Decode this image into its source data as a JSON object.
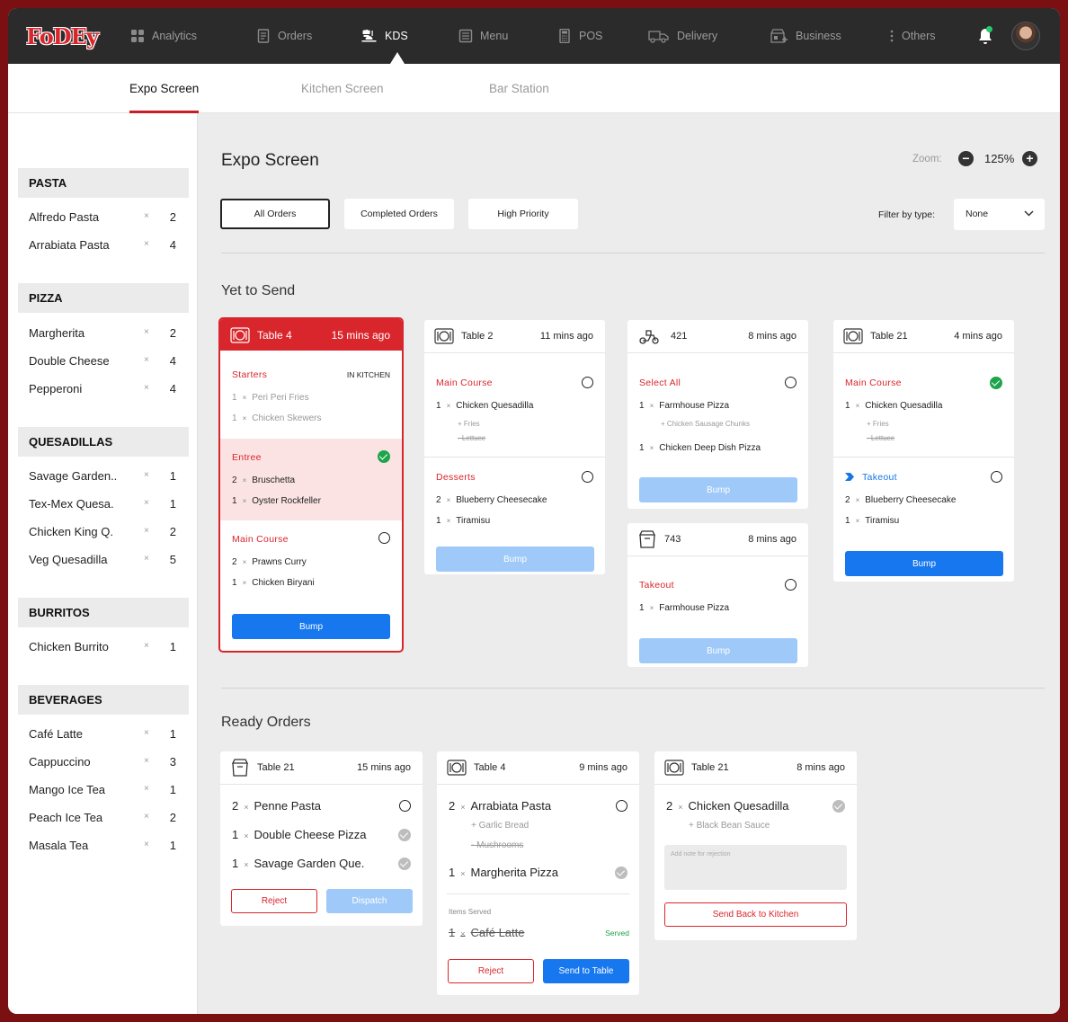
{
  "brand": {
    "logo": "FoDEy",
    "accent": "#d9262c"
  },
  "nav": {
    "items": [
      {
        "label": "Analytics",
        "icon": "grid-icon"
      },
      {
        "label": "Orders",
        "icon": "document-icon"
      },
      {
        "label": "KDS",
        "icon": "chef-icon",
        "active": true
      },
      {
        "label": "Menu",
        "icon": "book-icon"
      },
      {
        "label": "POS",
        "icon": "calculator-icon"
      },
      {
        "label": "Delivery",
        "icon": "truck-icon"
      },
      {
        "label": "Business",
        "icon": "store-icon"
      },
      {
        "label": "Others",
        "icon": "more-vertical-icon"
      }
    ]
  },
  "subnav": {
    "tabs": [
      "Expo Screen",
      "Kitchen Screen",
      "Bar Station"
    ],
    "active": 0
  },
  "sidebar": {
    "categories": [
      {
        "name": "PASTA",
        "items": [
          {
            "name": "Alfredo Pasta",
            "x": "×",
            "qty": "2"
          },
          {
            "name": "Arrabiata Pasta",
            "x": "×",
            "qty": "4"
          }
        ]
      },
      {
        "name": "PIZZA",
        "items": [
          {
            "name": "Margherita",
            "x": "×",
            "qty": "2"
          },
          {
            "name": "Double Cheese",
            "x": "×",
            "qty": "4"
          },
          {
            "name": "Pepperoni",
            "x": "×",
            "qty": "4"
          }
        ]
      },
      {
        "name": "QUESADILLAS",
        "items": [
          {
            "name": "Savage Garden..",
            "x": "×",
            "qty": "1"
          },
          {
            "name": "Tex-Mex Quesa.",
            "x": "×",
            "qty": "1"
          },
          {
            "name": "Chicken King Q.",
            "x": "×",
            "qty": "2"
          },
          {
            "name": "Veg Quesadilla",
            "x": "×",
            "qty": "5"
          }
        ]
      },
      {
        "name": "BURRITOS",
        "items": [
          {
            "name": "Chicken Burrito",
            "x": "×",
            "qty": "1"
          }
        ]
      },
      {
        "name": "BEVERAGES",
        "items": [
          {
            "name": "Café Latte",
            "x": "×",
            "qty": "1"
          },
          {
            "name": "Cappuccino",
            "x": "×",
            "qty": "3"
          },
          {
            "name": "Mango Ice Tea",
            "x": "×",
            "qty": "1"
          },
          {
            "name": "Peach Ice Tea",
            "x": "×",
            "qty": "2"
          },
          {
            "name": "Masala Tea",
            "x": "×",
            "qty": "1"
          }
        ]
      }
    ]
  },
  "main": {
    "title": "Expo Screen",
    "zoom_label": "Zoom:",
    "zoom_value": "125%",
    "filters": [
      "All Orders",
      "Completed Orders",
      "High Priority"
    ],
    "filter_by_label": "Filter by type:",
    "filter_type": "None"
  },
  "yet_to_send": {
    "title": "Yet to Send",
    "cards": [
      {
        "table": "Table 4",
        "time": "15 mins ago",
        "groups": [
          {
            "title": "Starters",
            "tag": "IN KITCHEN",
            "items": [
              {
                "q": "1",
                "x": "×",
                "name": "Peri Peri Fries"
              },
              {
                "q": "1",
                "x": "×",
                "name": "Chicken Skewers"
              }
            ]
          },
          {
            "title": "Entree",
            "items": [
              {
                "q": "2",
                "x": "×",
                "name": "Bruschetta"
              },
              {
                "q": "1",
                "x": "×",
                "name": "Oyster Rockfeller"
              }
            ]
          },
          {
            "title": "Main Course",
            "items": [
              {
                "q": "2",
                "x": "×",
                "name": "Prawns Curry"
              },
              {
                "q": "1",
                "x": "×",
                "name": "Chicken Biryani"
              }
            ]
          }
        ],
        "bump": "Bump"
      },
      {
        "table": "Table 2",
        "time": "11 mins ago",
        "groups": [
          {
            "title": "Main Course",
            "items": [
              {
                "q": "1",
                "x": "×",
                "name": "Chicken Quesadilla",
                "mods": [
                  "+ Fries",
                  "- Lettuce"
                ]
              }
            ]
          },
          {
            "title": "Desserts",
            "items": [
              {
                "q": "2",
                "x": "×",
                "name": "Blueberry Cheesecake"
              },
              {
                "q": "1",
                "x": "×",
                "name": "Tiramisu"
              }
            ]
          }
        ],
        "bump": "Bump"
      },
      {
        "table": "421",
        "time": "8 mins ago",
        "groups": [
          {
            "title": "Select All",
            "items": [
              {
                "q": "1",
                "x": "×",
                "name": "Farmhouse Pizza",
                "mods": [
                  "+ Chicken Sausage Chunks"
                ]
              },
              {
                "q": "1",
                "x": "×",
                "name": "Chicken Deep Dish Pizza"
              }
            ]
          }
        ],
        "bump": "Bump"
      },
      {
        "table": "743",
        "time": "8 mins ago",
        "groups": [
          {
            "title": "Takeout",
            "items": [
              {
                "q": "1",
                "x": "×",
                "name": "Farmhouse Pizza"
              }
            ]
          }
        ],
        "bump": "Bump"
      },
      {
        "table": "Table 21",
        "time": "4 mins ago",
        "groups": [
          {
            "title": "Main Course",
            "items": [
              {
                "q": "1",
                "x": "×",
                "name": "Chicken Quesadilla",
                "mods": [
                  "+ Fries",
                  "- Lettuce"
                ]
              }
            ]
          },
          {
            "title": "Takeout",
            "items": [
              {
                "q": "2",
                "x": "×",
                "name": "Blueberry Cheesecake"
              },
              {
                "q": "1",
                "x": "×",
                "name": "Tiramisu"
              }
            ]
          }
        ],
        "bump": "Bump"
      }
    ]
  },
  "ready": {
    "title": "Ready Orders",
    "cards": [
      {
        "table": "Table 21",
        "time": "15 mins ago",
        "items": [
          {
            "q": "2",
            "x": "×",
            "name": "Penne Pasta"
          },
          {
            "q": "1",
            "x": "×",
            "name": "Double Cheese Pizza"
          },
          {
            "q": "1",
            "x": "×",
            "name": "Savage Garden Que."
          }
        ],
        "reject": "Reject",
        "dispatch": "Dispatch"
      },
      {
        "table": "Table 4",
        "time": "9 mins ago",
        "items": [
          {
            "q": "2",
            "x": "×",
            "name": "Arrabiata Pasta",
            "mods": [
              "+ Garlic Bread",
              "- Mushrooms"
            ]
          },
          {
            "q": "1",
            "x": "×",
            "name": "Margherita Pizza"
          }
        ],
        "served_label": "Items Served",
        "served_item": {
          "q": "1",
          "x": "×",
          "name": "Café Latte",
          "tag": "Served"
        },
        "reject": "Reject",
        "send": "Send to Table"
      },
      {
        "table": "Table 21",
        "time": "8 mins ago",
        "items": [
          {
            "q": "2",
            "x": "×",
            "name": "Chicken Quesadilla",
            "mods": [
              "+ Black Bean Sauce"
            ]
          }
        ],
        "note_placeholder": "Add note for rejection",
        "send_back": "Send Back to Kitchen"
      }
    ]
  }
}
